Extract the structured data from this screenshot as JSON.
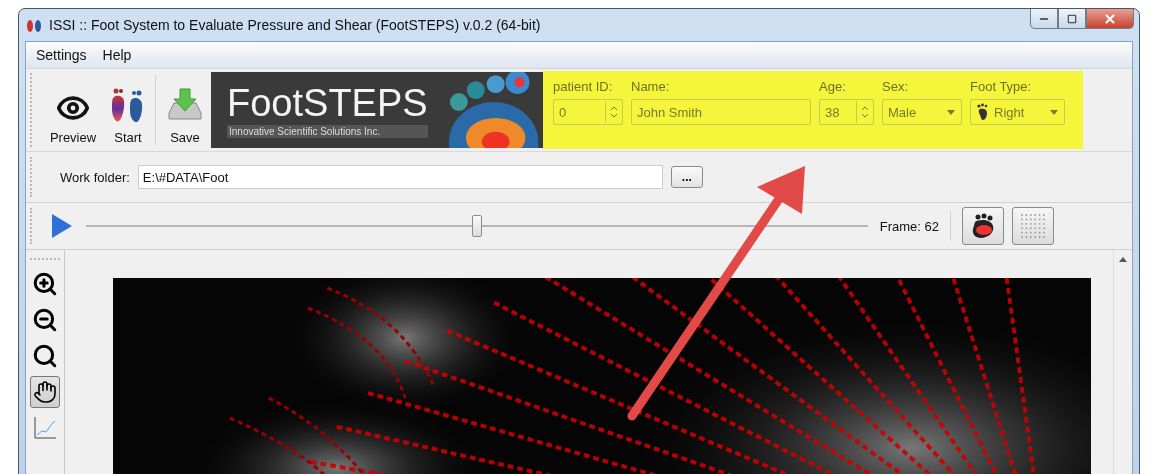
{
  "window": {
    "title": "ISSI :: Foot System to Evaluate Pressure and Shear (FootSTEPS) v.0.2 (64-bit)"
  },
  "menu": [
    "Settings",
    "Help"
  ],
  "toolbar": [
    {
      "kind": "eye",
      "label": "Preview"
    },
    {
      "kind": "feet",
      "label": "Start"
    },
    {
      "kind": "save",
      "label": "Save"
    }
  ],
  "logo": {
    "title": "FootSTEPS",
    "subtitle": "Innovative Scientific Solutions Inc."
  },
  "patient": [
    {
      "kind": "spin",
      "label": "patient ID:",
      "value": "0"
    },
    {
      "kind": "text",
      "label": "Name:",
      "value": "John Smith"
    },
    {
      "kind": "spin",
      "label": "Age:",
      "value": "38"
    },
    {
      "kind": "combo",
      "label": "Sex:",
      "value": "Male"
    },
    {
      "kind": "foot-combo",
      "label": "Foot Type:",
      "value": "Right"
    }
  ],
  "work_folder": {
    "label": "Work folder:",
    "value": "E:\\#DATA\\Foot",
    "browse": "..."
  },
  "player": {
    "level": 0.5,
    "frame": "Frame: 62",
    "views": [
      {
        "kind": "heatmap",
        "selected": false
      },
      {
        "kind": "grid",
        "selected": false
      }
    ]
  },
  "tools": [
    {
      "kind": "zoom-in",
      "selected": false
    },
    {
      "kind": "zoom-out",
      "selected": false
    },
    {
      "kind": "zoom",
      "selected": false
    },
    {
      "kind": "hand",
      "selected": true
    },
    {
      "kind": "chart",
      "selected": false
    }
  ]
}
